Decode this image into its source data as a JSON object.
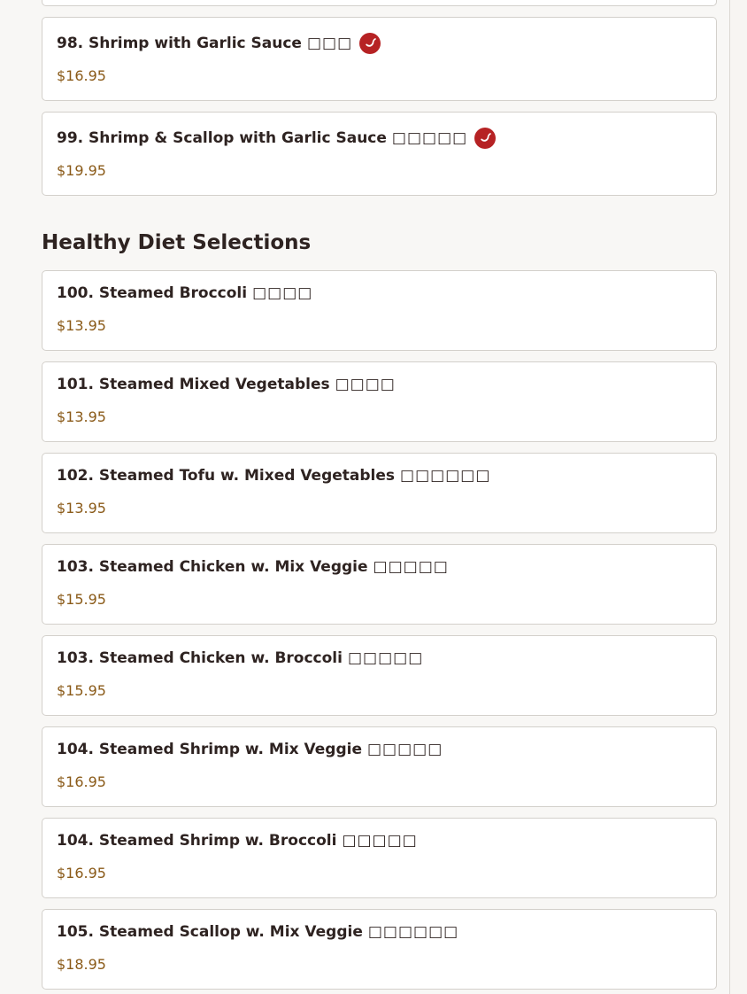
{
  "spicy_color": "#b62224",
  "price_color": "#8a5a18",
  "heading": "Healthy Diet Selections",
  "top_items": [
    {
      "name": "98. Shrimp with Garlic Sauce",
      "chinese": "□□□",
      "price": "$16.95",
      "spicy": true
    },
    {
      "name": "99. Shrimp & Scallop with Garlic Sauce",
      "chinese": "□□□□□",
      "price": "$19.95",
      "spicy": true
    }
  ],
  "items": [
    {
      "name": "100. Steamed Broccoli",
      "chinese": "□□□□",
      "price": "$13.95"
    },
    {
      "name": "101. Steamed Mixed Vegetables",
      "chinese": "□□□□",
      "price": "$13.95"
    },
    {
      "name": "102. Steamed Tofu w. Mixed Vegetables",
      "chinese": "□□□□□□",
      "price": "$13.95"
    },
    {
      "name": "103. Steamed Chicken w. Mix Veggie",
      "chinese": "□□□□□",
      "price": "$15.95"
    },
    {
      "name": "103. Steamed Chicken w. Broccoli",
      "chinese": "□□□□□",
      "price": "$15.95"
    },
    {
      "name": "104. Steamed Shrimp w. Mix Veggie",
      "chinese": "□□□□□",
      "price": "$16.95"
    },
    {
      "name": "104. Steamed Shrimp w. Broccoli",
      "chinese": "□□□□□",
      "price": "$16.95"
    },
    {
      "name": "105. Steamed Scallop w. Mix Veggie",
      "chinese": "□□□□□□",
      "price": "$18.95"
    }
  ]
}
